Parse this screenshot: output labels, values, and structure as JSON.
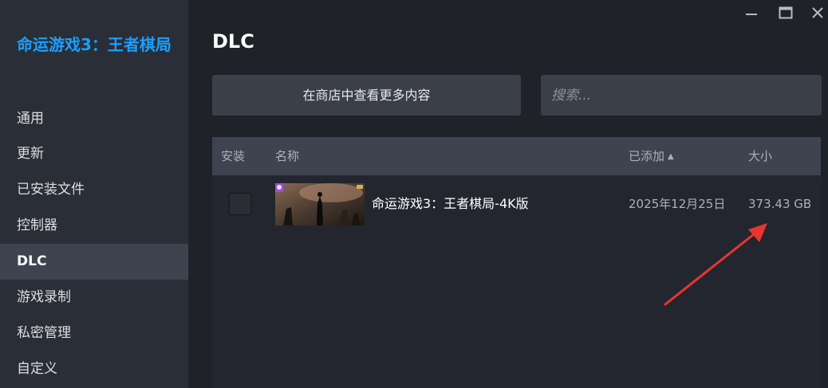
{
  "sidebar": {
    "game_title": "命运游戏3：王者棋局",
    "items": [
      {
        "label": "通用",
        "active": false
      },
      {
        "label": "更新",
        "active": false
      },
      {
        "label": "已安装文件",
        "active": false
      },
      {
        "label": "控制器",
        "active": false
      },
      {
        "label": "DLC",
        "active": true
      },
      {
        "label": "游戏录制",
        "active": false
      },
      {
        "label": "私密管理",
        "active": false
      },
      {
        "label": "自定义",
        "active": false
      }
    ]
  },
  "window_controls": {
    "minimize_icon": "minimize-icon",
    "maximize_icon": "maximize-icon",
    "close_icon": "close-icon"
  },
  "main": {
    "title": "DLC",
    "store_button_label": "在商店中查看更多内容",
    "search_placeholder": "搜索...",
    "table": {
      "headers": {
        "install": "安装",
        "name": "名称",
        "added": "已添加",
        "size": "大小"
      },
      "sort_indicator": "▲",
      "rows": [
        {
          "installed": false,
          "name": "命运游戏3：王者棋局-4K版",
          "added": "2025年12月25日",
          "size": "373.43 GB"
        }
      ]
    }
  },
  "colors": {
    "accent": "#1a9fff",
    "sidebar_bg": "#2a2e36",
    "active_item_bg": "#3d4450",
    "annotation_arrow": "#e8362d"
  }
}
